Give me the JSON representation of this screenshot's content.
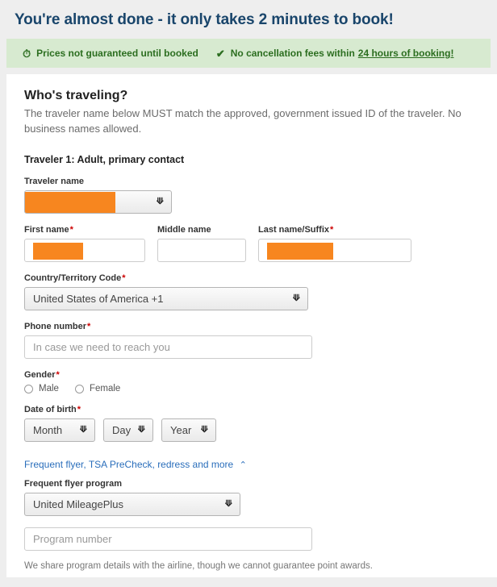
{
  "header": {
    "title": "You're almost done - it only takes 2 minutes to book!"
  },
  "assurance": {
    "clock_icon": "clock-icon",
    "price_text": "Prices not guaranteed until booked",
    "check_icon": "check-icon",
    "cancellation_text": "No cancellation fees within",
    "cancellation_link": "24 hours of booking!"
  },
  "section": {
    "title": "Who's traveling?",
    "description": "The traveler name below MUST match the approved, government issued ID of the traveler. No business names allowed.",
    "traveler_heading": "Traveler 1: Adult, primary contact"
  },
  "form": {
    "traveler_name_label": "Traveler name",
    "traveler_name_value": "",
    "first_name_label": "First name",
    "first_name_value": "",
    "middle_name_label": "Middle name",
    "middle_name_value": "",
    "last_name_label": "Last name/Suffix",
    "last_name_value": "",
    "country_code_label": "Country/Territory Code",
    "country_code_value": "United States of America +1",
    "phone_label": "Phone number",
    "phone_placeholder": "In case we need to reach you",
    "gender_label": "Gender",
    "gender_male": "Male",
    "gender_female": "Female",
    "dob_label": "Date of birth",
    "dob_month": "Month",
    "dob_day": "Day",
    "dob_year": "Year",
    "required_marker": "*",
    "chevron_down": "⌄"
  },
  "frequent_flyer": {
    "toggle_text": "Frequent flyer, TSA PreCheck, redress and more",
    "toggle_caret": "⌃",
    "program_label": "Frequent flyer program",
    "program_value": "United MileagePlus",
    "number_placeholder": "Program number",
    "note": "We share program details with the airline, though we cannot guarantee point awards."
  },
  "colors": {
    "heading": "#19456b",
    "banner_bg": "#d7ead0",
    "banner_text": "#2c6e20",
    "redaction": "#f7861f",
    "link": "#2a6ebb",
    "required": "#cc0000"
  }
}
